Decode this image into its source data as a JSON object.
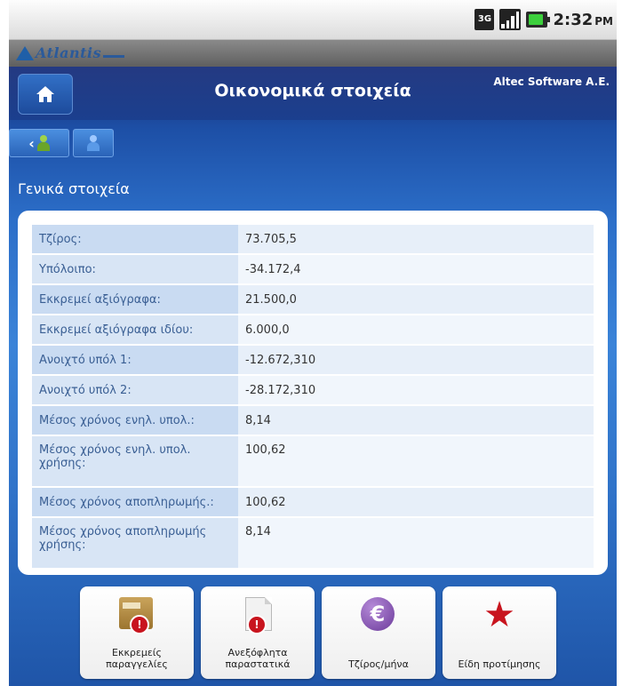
{
  "status_bar": {
    "network": "3G",
    "time": "2:32",
    "ampm": "PM"
  },
  "app": {
    "logo_text": "Atlantis"
  },
  "header": {
    "title": "Οικονομικά στοιχεία",
    "company": "Altec Software A.E."
  },
  "toolbar": {
    "back_arrow": "‹"
  },
  "section": {
    "title": "Γενικά στοιχεία"
  },
  "rows": [
    {
      "label": "Τζίρος:",
      "value": "73.705,5"
    },
    {
      "label": "Υπόλοιπο:",
      "value": "-34.172,4"
    },
    {
      "label": "Εκκρεμεί αξιόγραφα:",
      "value": "21.500,0"
    },
    {
      "label": "Εκκρεμεί αξιόγραφα ιδίου:",
      "value": "6.000,0"
    },
    {
      "label": "Ανοιχτό υπόλ 1:",
      "value": "-12.672,310"
    },
    {
      "label": "Ανοιχτό υπόλ 2:",
      "value": "-28.172,310"
    },
    {
      "label": "Μέσος χρόνος ενηλ. υπολ.:",
      "value": "8,14"
    },
    {
      "label": "Μέσος χρόνος ενηλ. υπολ. χρήσης:",
      "value": "100,62"
    },
    {
      "label": "Μέσος χρόνος αποπληρωμής.:",
      "value": "100,62"
    },
    {
      "label": "Μέσος χρόνος αποπληρωμής χρήσης:",
      "value": "8,14"
    }
  ],
  "tiles": [
    {
      "label": "Εκκρεμείς παραγγελίες",
      "icon": "pending-orders-icon"
    },
    {
      "label": "Ανεξόφλητα παραστατικά",
      "icon": "unpaid-documents-icon"
    },
    {
      "label": "Τζίρος/μήνα",
      "icon": "euro-icon"
    },
    {
      "label": "Είδη προτίμησης",
      "icon": "star-icon"
    }
  ],
  "colors": {
    "header": "#1b3f8e",
    "label_cell": "#c9dbf2",
    "value_cell": "#e7eff9",
    "accent_red": "#c8141e"
  }
}
